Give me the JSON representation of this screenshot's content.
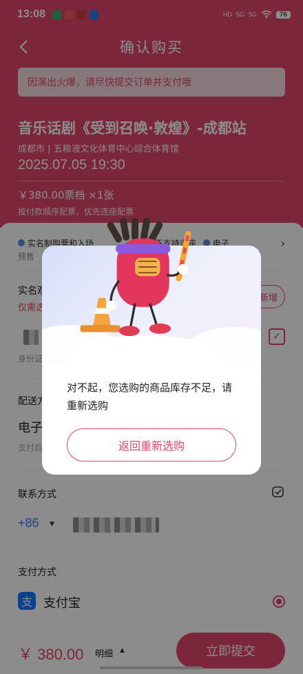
{
  "status_bar": {
    "time": "13:08",
    "network_1": "5G",
    "network_2": "5G",
    "hd": "HD",
    "battery": "76"
  },
  "header": {
    "title": "确认购买"
  },
  "notice": "因演出火爆，请尽快提交订单并支付哦",
  "event": {
    "title": "音乐话剧《受到召唤·敦煌》-成都站",
    "venue": "成都市 | 五粮液文化体育中心综合体育馆",
    "datetime": "2025.07.05 19:30",
    "ticket": "￥380.00票档 ×1张",
    "ticket_note": "按付款顺序配票，优先连座配票"
  },
  "services": {
    "item_1": "实名制购票和入场",
    "item_2": "不支持选座",
    "item_3": "电子",
    "presale": "预售"
  },
  "real_name": {
    "title": "实名观",
    "requirement": "仅需选",
    "add_label": "新增",
    "id_label": "身份证",
    "checkbox_mark": "✓"
  },
  "delivery": {
    "title": "配送方式",
    "method": "电子",
    "method_note": "支付后"
  },
  "contact": {
    "title": "联系方式",
    "country_code": "+86"
  },
  "payment": {
    "title": "支付方式",
    "method": "支付宝",
    "logo_char": "支"
  },
  "bottom_bar": {
    "price": "￥ 380.00",
    "detail_label": "明细",
    "submit_label": "立即提交"
  },
  "modal": {
    "message": "对不起，您选购的商品库存不足，请重新选购",
    "button_label": "返回重新选购"
  },
  "colors": {
    "brand": "#e0456c",
    "link": "#2b7be6",
    "alipay": "#1677ff"
  }
}
